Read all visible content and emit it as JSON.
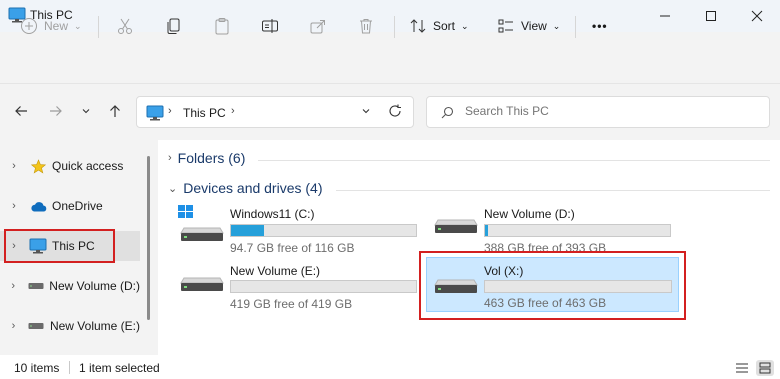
{
  "window": {
    "title": "This PC"
  },
  "toolbar": {
    "new_label": "New",
    "sort_label": "Sort",
    "view_label": "View",
    "more_label": "•••"
  },
  "address": {
    "location": "This PC"
  },
  "search": {
    "placeholder": "Search This PC"
  },
  "sidebar": {
    "items": [
      {
        "label": "Quick access",
        "icon": "star-icon"
      },
      {
        "label": "OneDrive",
        "icon": "cloud-icon"
      },
      {
        "label": "This PC",
        "icon": "monitor-icon"
      },
      {
        "label": "New Volume (D:)",
        "icon": "drive-icon"
      },
      {
        "label": "New Volume (E:)",
        "icon": "drive-icon"
      }
    ]
  },
  "folders": {
    "label": "Folders (6)"
  },
  "devices": {
    "label": "Devices and drives (4)",
    "drives": [
      {
        "name": "Windows11 (C:)",
        "free_text": "94.7 GB free of 116 GB",
        "used_fraction": 0.18
      },
      {
        "name": "New Volume (D:)",
        "free_text": "388 GB free of 393 GB",
        "used_fraction": 0.013
      },
      {
        "name": "New Volume (E:)",
        "free_text": "419 GB free of 419 GB",
        "used_fraction": 0.0
      },
      {
        "name": "Vol (X:)",
        "free_text": "463 GB free of 463 GB",
        "used_fraction": 0.0
      }
    ]
  },
  "status": {
    "items": "10 items",
    "selected": "1 item selected"
  },
  "colors": {
    "accent": "#26a0da",
    "highlight": "#cce8ff",
    "annotation": "#d32020"
  }
}
